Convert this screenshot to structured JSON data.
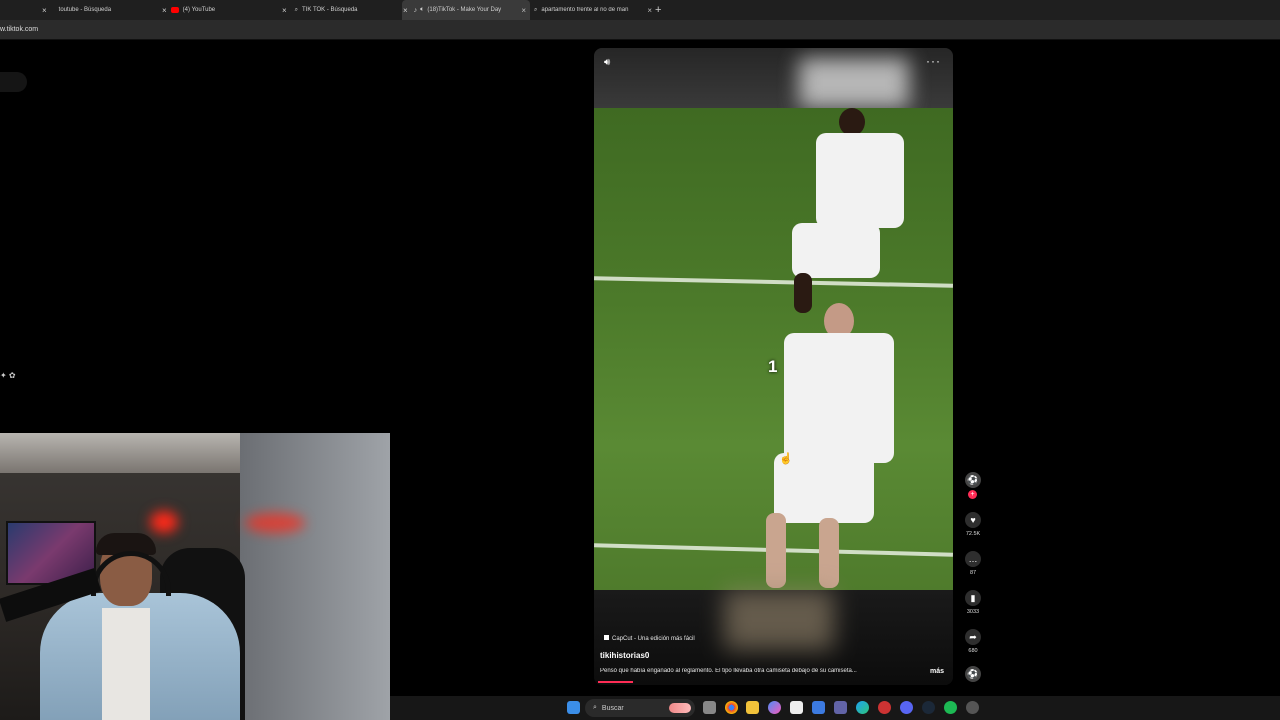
{
  "browser": {
    "tabs": [
      {
        "label": "toutube - Búsqueda",
        "active": false
      },
      {
        "label": "(4) YouTube",
        "active": false
      },
      {
        "label": "TIK TOK - Búsqueda",
        "active": false
      },
      {
        "label": "(18)TikTok - Make Your Day",
        "active": true
      },
      {
        "label": "apartamento frente al rio de man",
        "active": false
      }
    ],
    "close_glyph": "×",
    "new_tab_glyph": "+",
    "address": "w.tiktok.com"
  },
  "video": {
    "overlay_number": "1",
    "capcut_label": "CapCut - Una edición más fácil",
    "author": "tikihistorias0",
    "description": "Pensó que había engañado al reglamento. El tipo llevaba otra camiseta debajo de su camiseta...",
    "more_label": "más",
    "progress": 0.1,
    "icons": {
      "volume": "volume-icon",
      "more": "more-options-icon"
    }
  },
  "actions": {
    "likes": "72.5K",
    "comments": "87",
    "saves": "3033",
    "shares": "680"
  },
  "taskbar": {
    "search_placeholder": "Buscar"
  },
  "colors": {
    "accent": "#fe2c55",
    "field_green": "#4c7a2a",
    "tab_bar": "#1f1f1f"
  }
}
